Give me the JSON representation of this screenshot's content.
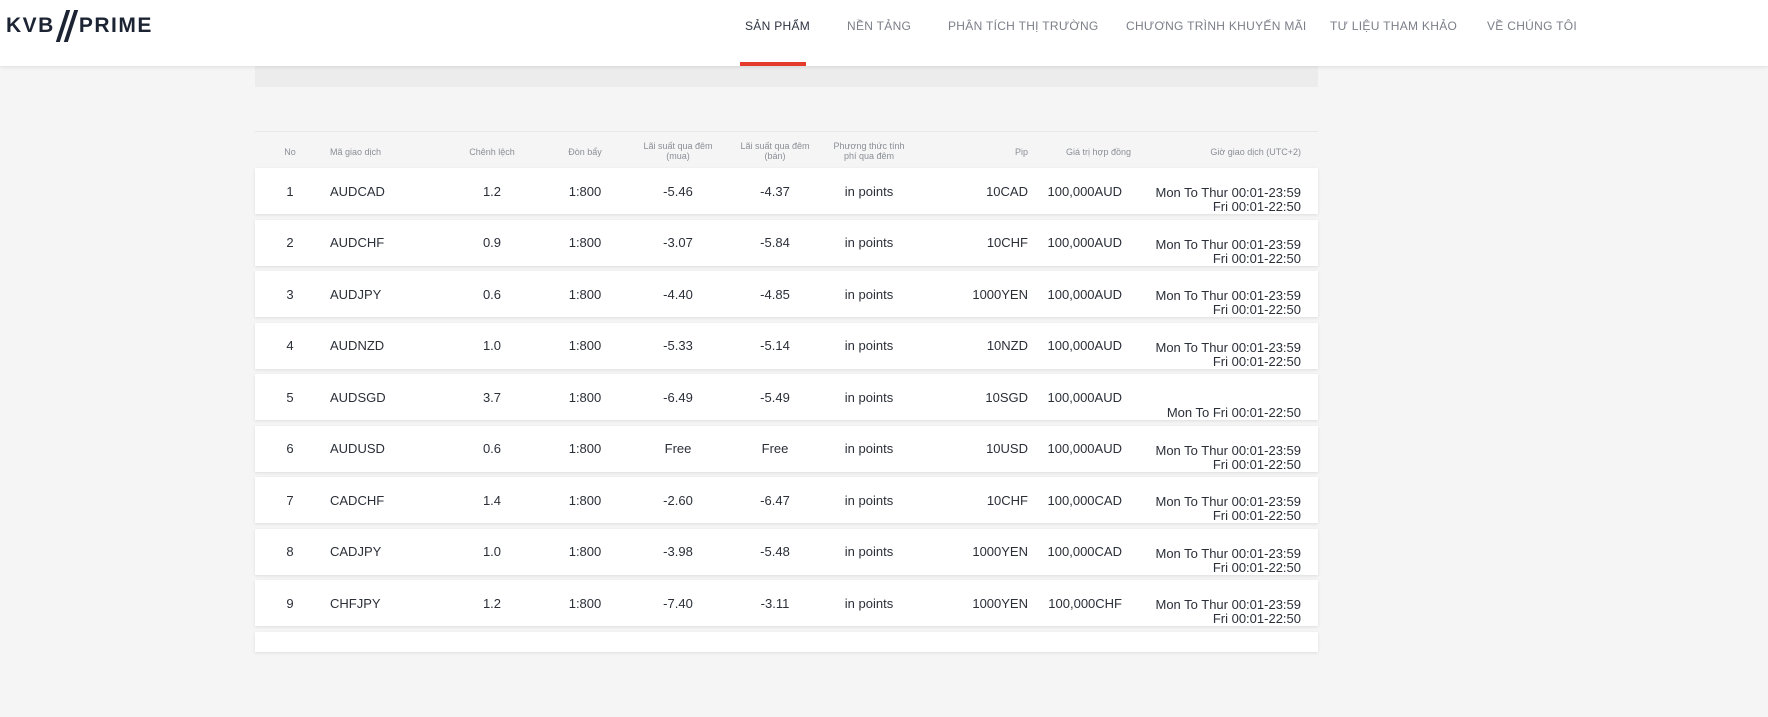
{
  "logo": {
    "left_text": "KVB",
    "right_text": "PRIME"
  },
  "nav": {
    "items": [
      {
        "label": "SẢN PHẨM",
        "active": true
      },
      {
        "label": "NỀN TẢNG",
        "active": false
      },
      {
        "label": "PHÂN TÍCH THỊ TRƯỜNG",
        "active": false
      },
      {
        "label": "CHƯƠNG TRÌNH KHUYẾN MÃI",
        "active": false
      },
      {
        "label": "TƯ LIỆU THAM KHẢO",
        "active": false
      },
      {
        "label": "VỀ CHÚNG TÔI",
        "active": false
      }
    ],
    "accent_color": "#e53b2c"
  },
  "table": {
    "headers": {
      "no": "No",
      "symbol": "Mã giao dịch",
      "spread": "Chênh lệch",
      "leverage": "Đòn bẩy",
      "swap_buy_1": "Lãi suất qua đêm",
      "swap_buy_2": "(mua)",
      "swap_sell_1": "Lãi suất qua đêm",
      "swap_sell_2": "(bán)",
      "method_1": "Phương thức tính",
      "method_2": "phí qua đêm",
      "pip": "Pip",
      "contract": "Giá trị hợp đồng",
      "hours": "Giờ giao dịch (UTC+2)"
    },
    "rows": [
      {
        "no": "1",
        "symbol": "AUDCAD",
        "spread": "1.2",
        "leverage": "1:800",
        "swap_buy": "-5.46",
        "swap_sell": "-4.37",
        "method": "in points",
        "pip": "10CAD",
        "contract": "100,000AUD",
        "hours_1": "Mon To Thur 00:01-23:59",
        "hours_2": "Fri 00:01-22:50"
      },
      {
        "no": "2",
        "symbol": "AUDCHF",
        "spread": "0.9",
        "leverage": "1:800",
        "swap_buy": "-3.07",
        "swap_sell": "-5.84",
        "method": "in points",
        "pip": "10CHF",
        "contract": "100,000AUD",
        "hours_1": "Mon To Thur 00:01-23:59",
        "hours_2": "Fri 00:01-22:50"
      },
      {
        "no": "3",
        "symbol": "AUDJPY",
        "spread": "0.6",
        "leverage": "1:800",
        "swap_buy": "-4.40",
        "swap_sell": "-4.85",
        "method": "in points",
        "pip": "1000YEN",
        "contract": "100,000AUD",
        "hours_1": "Mon To Thur 00:01-23:59",
        "hours_2": "Fri 00:01-22:50"
      },
      {
        "no": "4",
        "symbol": "AUDNZD",
        "spread": "1.0",
        "leverage": "1:800",
        "swap_buy": "-5.33",
        "swap_sell": "-5.14",
        "method": "in points",
        "pip": "10NZD",
        "contract": "100,000AUD",
        "hours_1": "Mon To Thur 00:01-23:59",
        "hours_2": "Fri 00:01-22:50"
      },
      {
        "no": "5",
        "symbol": "AUDSGD",
        "spread": "3.7",
        "leverage": "1:800",
        "swap_buy": "-6.49",
        "swap_sell": "-5.49",
        "method": "in points",
        "pip": "10SGD",
        "contract": "100,000AUD",
        "hours_1": "Mon To Fri 00:01-22:50",
        "hours_2": ""
      },
      {
        "no": "6",
        "symbol": "AUDUSD",
        "spread": "0.6",
        "leverage": "1:800",
        "swap_buy": "Free",
        "swap_sell": "Free",
        "method": "in points",
        "pip": "10USD",
        "contract": "100,000AUD",
        "hours_1": "Mon To Thur 00:01-23:59",
        "hours_2": "Fri 00:01-22:50"
      },
      {
        "no": "7",
        "symbol": "CADCHF",
        "spread": "1.4",
        "leverage": "1:800",
        "swap_buy": "-2.60",
        "swap_sell": "-6.47",
        "method": "in points",
        "pip": "10CHF",
        "contract": "100,000CAD",
        "hours_1": "Mon To Thur 00:01-23:59",
        "hours_2": "Fri 00:01-22:50"
      },
      {
        "no": "8",
        "symbol": "CADJPY",
        "spread": "1.0",
        "leverage": "1:800",
        "swap_buy": "-3.98",
        "swap_sell": "-5.48",
        "method": "in points",
        "pip": "1000YEN",
        "contract": "100,000CAD",
        "hours_1": "Mon To Thur 00:01-23:59",
        "hours_2": "Fri 00:01-22:50"
      },
      {
        "no": "9",
        "symbol": "CHFJPY",
        "spread": "1.2",
        "leverage": "1:800",
        "swap_buy": "-7.40",
        "swap_sell": "-3.11",
        "method": "in points",
        "pip": "1000YEN",
        "contract": "100,000CHF",
        "hours_1": "Mon To Thur 00:01-23:59",
        "hours_2": "Fri 00:01-22:50"
      }
    ]
  }
}
